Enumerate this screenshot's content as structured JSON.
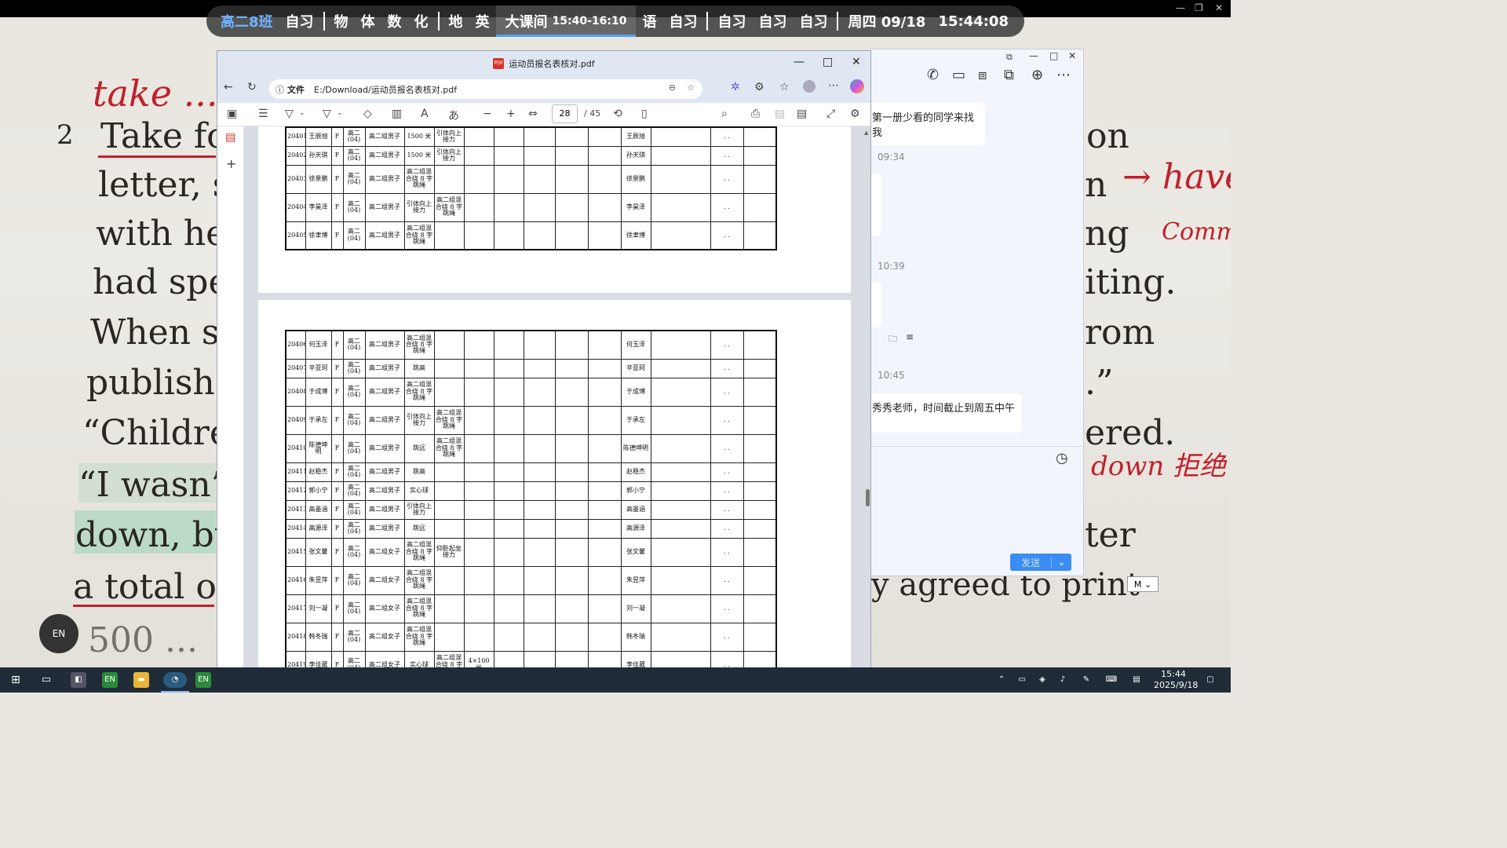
{
  "schedule": {
    "class_name": "高二8班",
    "items_a": [
      "自习"
    ],
    "items_b": [
      "物",
      "体",
      "数",
      "化"
    ],
    "items_c": [
      "地",
      "英"
    ],
    "current_label": "大课间",
    "current_time": "15:40-16:10",
    "items_d": [
      "语",
      "自习"
    ],
    "items_e": [
      "自习",
      "自习",
      "自习"
    ],
    "date": "周四 09/18",
    "clock": "15:44:08"
  },
  "book": {
    "lines": [
      "2",
      "Take fo",
      "letter, sh",
      "with her",
      "had sper",
      "When sh",
      "publisher",
      "“Childre",
      "“I wasn’t",
      "down, bu",
      "a total of",
      "500 ..."
    ],
    "right": [
      "on",
      "n",
      "ng",
      "iting.",
      "rom",
      ".”",
      "ered.",
      "ter",
      "y agreed to print"
    ]
  },
  "handwriting": {
    "top": "take ... f",
    "right1": "→ have",
    "right2": "Comm",
    "right3": "down 拒绝"
  },
  "chat": {
    "msg1": "第一册少看的同学来找我",
    "time1": "09:34",
    "time2": "10:39",
    "time3": "10:45",
    "msg2": "秀秀老师，时间截止到周五中午",
    "send": "发送"
  },
  "pdf": {
    "title": "运动员报名表核对.pdf",
    "scheme": "文件",
    "path": "E:/Download/运动员报名表核对.pdf",
    "page": "28",
    "total": "/ 45"
  },
  "table1": [
    {
      "id": "20401",
      "name": "王辰旭",
      "g": "F",
      "cls": "高二(04)",
      "grp": "高二组男子",
      "e1": "1500 米",
      "e2": "引体向上接力",
      "sign": "王辰旭"
    },
    {
      "id": "20402",
      "name": "孙天琪",
      "g": "F",
      "cls": "高二(04)",
      "grp": "高二组男子",
      "e1": "1500 米",
      "e2": "引体向上接力",
      "sign": "孙天琪"
    },
    {
      "id": "20403",
      "name": "徐景鹏",
      "g": "F",
      "cls": "高二(04)",
      "grp": "高二组男子",
      "e1": "高二组混合绕 8 字跳绳",
      "e2": "",
      "sign": "徐景鹏"
    },
    {
      "id": "20404",
      "name": "李昊泽",
      "g": "F",
      "cls": "高二(04)",
      "grp": "高二组男子",
      "e1": "引体向上接力",
      "e2": "高二组混合绕 8 字跳绳",
      "sign": "李昊泽"
    },
    {
      "id": "20405",
      "name": "徐聿博",
      "g": "F",
      "cls": "高二(04)",
      "grp": "高二组男子",
      "e1": "高二组混合绕 8 字跳绳",
      "e2": "",
      "sign": "徐聿博"
    }
  ],
  "table2": [
    {
      "id": "20406",
      "name": "何玉泽",
      "g": "F",
      "cls": "高二(04)",
      "grp": "高二组男子",
      "e1": "高二组混合绕 8 字跳绳",
      "e2": "",
      "sign": "何玉泽"
    },
    {
      "id": "20407",
      "name": "辛亚珂",
      "g": "F",
      "cls": "高二(04)",
      "grp": "高二组男子",
      "e1": "跳高",
      "e2": "",
      "sign": "辛亚珂"
    },
    {
      "id": "20408",
      "name": "于成博",
      "g": "F",
      "cls": "高二(04)",
      "grp": "高二组男子",
      "e1": "高二组混合绕 8 字跳绳",
      "e2": "",
      "sign": "于成博"
    },
    {
      "id": "20409",
      "name": "于承左",
      "g": "F",
      "cls": "高二(04)",
      "grp": "高二组男子",
      "e1": "引体向上接力",
      "e2": "高二组混合绕 8 字跳绳",
      "sign": "于承左"
    },
    {
      "id": "20410",
      "name": "陈德坤明",
      "g": "F",
      "cls": "高二(04)",
      "grp": "高二组男子",
      "e1": "跳远",
      "e2": "高二组混合绕 8 字跳绳",
      "sign": "陈德坤明"
    },
    {
      "id": "20411",
      "name": "赵稳杰",
      "g": "F",
      "cls": "高二(04)",
      "grp": "高二组男子",
      "e1": "跳高",
      "e2": "",
      "sign": "赵稳杰"
    },
    {
      "id": "20412",
      "name": "郭小宁",
      "g": "F",
      "cls": "高二(04)",
      "grp": "高二组男子",
      "e1": "实心球",
      "e2": "",
      "sign": "郭小宁"
    },
    {
      "id": "20413",
      "name": "高墨涵",
      "g": "F",
      "cls": "高二(04)",
      "grp": "高二组男子",
      "e1": "引体向上接力",
      "e2": "",
      "sign": "高墨涵"
    },
    {
      "id": "20414",
      "name": "高源泽",
      "g": "F",
      "cls": "高二(04)",
      "grp": "高二组男子",
      "e1": "跳远",
      "e2": "",
      "sign": "高源泽"
    },
    {
      "id": "20415",
      "name": "张文馨",
      "g": "F",
      "cls": "高二(04)",
      "grp": "高二组女子",
      "e1": "高二组混合绕 8 字跳绳",
      "e2": "仰卧起坐接力",
      "sign": "张文馨"
    },
    {
      "id": "20416",
      "name": "朱昱萍",
      "g": "F",
      "cls": "高二(04)",
      "grp": "高二组女子",
      "e1": "高二组混合绕 8 字跳绳",
      "e2": "",
      "sign": "朱昱萍"
    },
    {
      "id": "20417",
      "name": "刘一凝",
      "g": "F",
      "cls": "高二(04)",
      "grp": "高二组女子",
      "e1": "高二组混合绕 8 字跳绳",
      "e2": "",
      "sign": "刘一凝"
    },
    {
      "id": "20418",
      "name": "韩冬瑞",
      "g": "F",
      "cls": "高二(04)",
      "grp": "高二组女子",
      "e1": "高二组混合绕 8 字跳绳",
      "e2": "",
      "sign": "韩冬瑞"
    },
    {
      "id": "20419",
      "name": "李佳葳",
      "g": "F",
      "cls": "高二(04)",
      "grp": "高二组女子",
      "e1": "实心球",
      "e2": "高二组混合绕 8 字跳绳",
      "e3": "4×100 米",
      "sign": "李佳葳"
    }
  ],
  "dots": ". .",
  "taskbar": {
    "time": "15:44",
    "date": "2025/9/18",
    "en": "EN",
    "ime": "M"
  }
}
